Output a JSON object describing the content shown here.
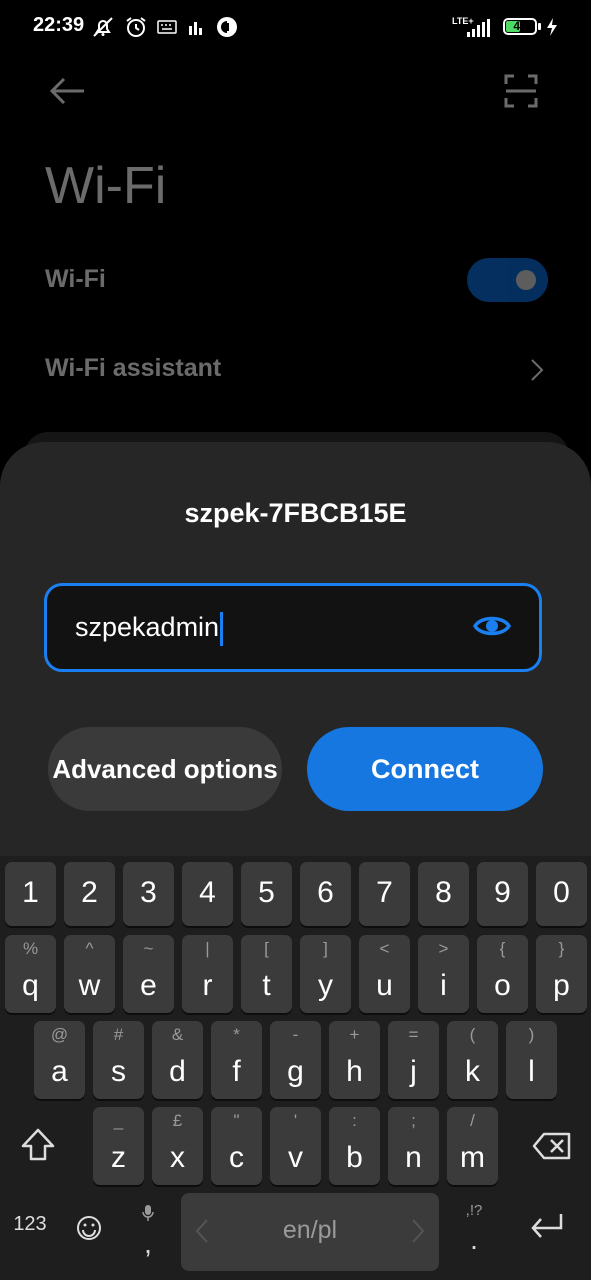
{
  "status_bar": {
    "time": "22:39",
    "network": "LTE+",
    "battery": "48",
    "icons": [
      "mute-icon",
      "alarm-icon",
      "keyboard-icon",
      "signal-bars-icon",
      "app-icon",
      "cellular-signal-icon",
      "battery-icon",
      "charging-icon"
    ]
  },
  "settings": {
    "title": "Wi-Fi",
    "rows": [
      {
        "label": "Wi-Fi",
        "toggle": "on"
      },
      {
        "label": "Wi-Fi assistant"
      }
    ],
    "icons": [
      "back-arrow-icon",
      "scan-icon",
      "chevron-right-icon"
    ]
  },
  "dialog": {
    "network_name": "szpek-7FBCB15E",
    "password_value": "szpekadmin",
    "advanced_label": "Advanced options",
    "connect_label": "Connect",
    "colors": {
      "accent": "#1677e0",
      "dialog_bg": "#262626"
    }
  },
  "keyboard": {
    "numbers": [
      "1",
      "2",
      "3",
      "4",
      "5",
      "6",
      "7",
      "8",
      "9",
      "0"
    ],
    "row1": [
      {
        "k": "q",
        "a": "%"
      },
      {
        "k": "w",
        "a": "^"
      },
      {
        "k": "e",
        "a": "~"
      },
      {
        "k": "r",
        "a": "|"
      },
      {
        "k": "t",
        "a": "["
      },
      {
        "k": "y",
        "a": "]"
      },
      {
        "k": "u",
        "a": "<"
      },
      {
        "k": "i",
        "a": ">"
      },
      {
        "k": "o",
        "a": "{"
      },
      {
        "k": "p",
        "a": "}"
      }
    ],
    "row2": [
      {
        "k": "a",
        "a": "@"
      },
      {
        "k": "s",
        "a": "#"
      },
      {
        "k": "d",
        "a": "&"
      },
      {
        "k": "f",
        "a": "*"
      },
      {
        "k": "g",
        "a": "-"
      },
      {
        "k": "h",
        "a": "+"
      },
      {
        "k": "j",
        "a": "="
      },
      {
        "k": "k",
        "a": "("
      },
      {
        "k": "l",
        "a": ")"
      }
    ],
    "row3": [
      {
        "k": "z",
        "a": "_"
      },
      {
        "k": "x",
        "a": "£"
      },
      {
        "k": "c",
        "a": "\""
      },
      {
        "k": "v",
        "a": "'"
      },
      {
        "k": "b",
        "a": ":"
      },
      {
        "k": "n",
        "a": ";"
      },
      {
        "k": "m",
        "a": "/"
      }
    ],
    "mode_label": "123",
    "comma": ",",
    "period": ".",
    "period_alt": ",!?",
    "space_label": "en/pl"
  }
}
